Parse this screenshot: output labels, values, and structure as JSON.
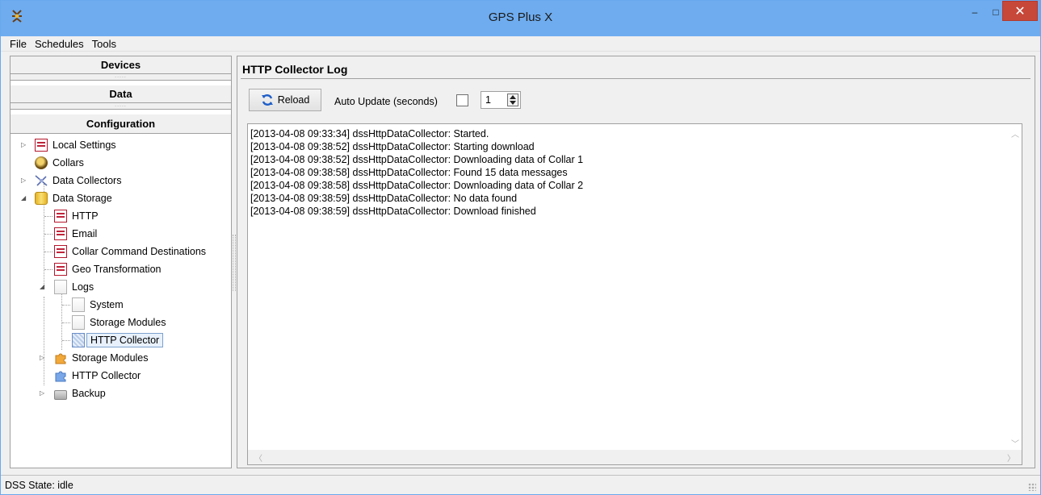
{
  "window": {
    "title": "GPS Plus X",
    "minimize_glyph": "–",
    "maximize_glyph": "□",
    "close_glyph": "✕"
  },
  "menu": [
    "File",
    "Schedules",
    "Tools"
  ],
  "left": {
    "sections": [
      "Devices",
      "Data",
      "Configuration"
    ],
    "grip": ".....",
    "tree": [
      {
        "label": "Local Settings",
        "icon": "checklist-icon"
      },
      {
        "label": "Collars",
        "icon": "collar-bulb-icon"
      },
      {
        "label": "Data Collectors",
        "icon": "satellite-icon"
      },
      {
        "label": "Data Storage",
        "icon": "database-icon"
      },
      {
        "label": "HTTP",
        "icon": "checklist-icon"
      },
      {
        "label": "Email",
        "icon": "checklist-icon"
      },
      {
        "label": "Collar Command Destinations",
        "icon": "checklist-icon"
      },
      {
        "label": "Geo Transformation",
        "icon": "checklist-icon"
      },
      {
        "label": "Logs",
        "icon": "log-page-icon"
      },
      {
        "label": "System",
        "icon": "page-icon"
      },
      {
        "label": "Storage Modules",
        "icon": "page-icon"
      },
      {
        "label": "HTTP Collector",
        "icon": "page-selected-icon"
      },
      {
        "label": "Storage Modules",
        "icon": "puzzle-icon"
      },
      {
        "label": "HTTP Collector",
        "icon": "puzzle-blue-icon"
      },
      {
        "label": "Backup",
        "icon": "printer-icon"
      }
    ]
  },
  "right": {
    "title": "HTTP Collector Log",
    "reload_label": "Reload",
    "auto_update_label": "Auto Update (seconds)",
    "spin_value": "1",
    "log": [
      "[2013-04-08 09:33:34] dssHttpDataCollector: Started.",
      "[2013-04-08 09:38:52] dssHttpDataCollector: Starting download",
      "[2013-04-08 09:38:52] dssHttpDataCollector: Downloading data of Collar 1",
      "[2013-04-08 09:38:58] dssHttpDataCollector: Found 15 data messages",
      "[2013-04-08 09:38:58] dssHttpDataCollector: Downloading data of Collar 2",
      "[2013-04-08 09:38:59] dssHttpDataCollector: No data found",
      "[2013-04-08 09:38:59] dssHttpDataCollector: Download finished"
    ]
  },
  "status": "DSS State: idle",
  "colors": {
    "titlebar": "#6eacef",
    "close": "#c74739",
    "selection_border": "#7da2ce"
  }
}
